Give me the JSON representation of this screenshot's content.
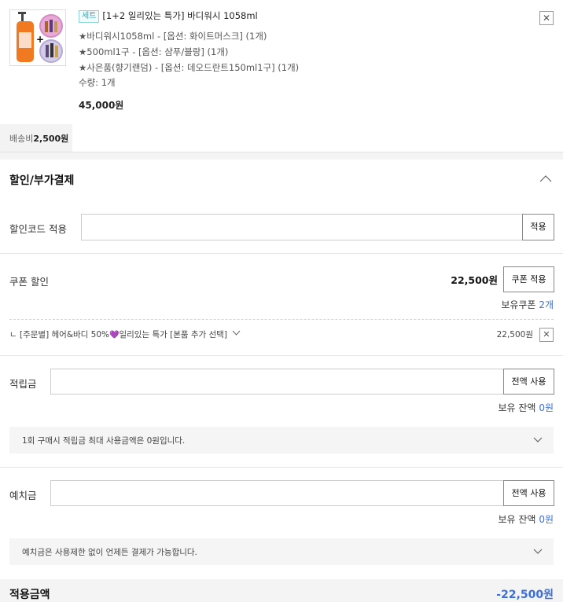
{
  "product": {
    "badge": "세트",
    "name": "[1+2 일리있는 특가] 바디워시 1058ml",
    "options": [
      "★바디워시1058ml - [옵션: 화이트머스크] (1개)",
      "★500ml1구 - [옵션: 샴푸/블랑] (1개)",
      "★사은품(향기랜덤) - [옵션: 데오드란트150ml1구] (1개)"
    ],
    "quantity": "수량: 1개",
    "price": "45,000원"
  },
  "shipping": {
    "label": "배송비",
    "value": "2,500원"
  },
  "discount": {
    "title": "할인/부가결제",
    "code": {
      "label": "할인코드 적용",
      "value": "",
      "button": "적용"
    },
    "coupon": {
      "label": "쿠폰 할인",
      "amount": "22,500원",
      "button": "쿠폰 적용",
      "owned_label": "보유쿠폰",
      "owned_count": "2개",
      "applied_prefix": "ㄴ [주문별] 헤어&바디 50%",
      "applied_heart": "💜",
      "applied_suffix": "일리있는 특가 [본품 추가 선택]",
      "applied_amount": "22,500원"
    },
    "points": {
      "label": "적립금",
      "value": "",
      "button": "전액 사용",
      "balance_label": "보유 잔액",
      "balance": "0원",
      "info": "1회 구매시 적립금 최대 사용금액은 0원입니다."
    },
    "deposit": {
      "label": "예치금",
      "value": "",
      "button": "전액 사용",
      "balance_label": "보유 잔액",
      "balance": "0원",
      "info": "예치금은 사용제한 없이 언제든 결제가 가능합니다."
    },
    "total": {
      "label": "적용금액",
      "value": "-22,500원"
    }
  },
  "icons": {
    "close": "close-icon",
    "collapse": "chevron-up-icon",
    "expand": "chevron-down-icon",
    "remove_coupon": "close-icon"
  },
  "colors": {
    "accent": "#3d6fd8",
    "badge": "#2aa4b8"
  }
}
